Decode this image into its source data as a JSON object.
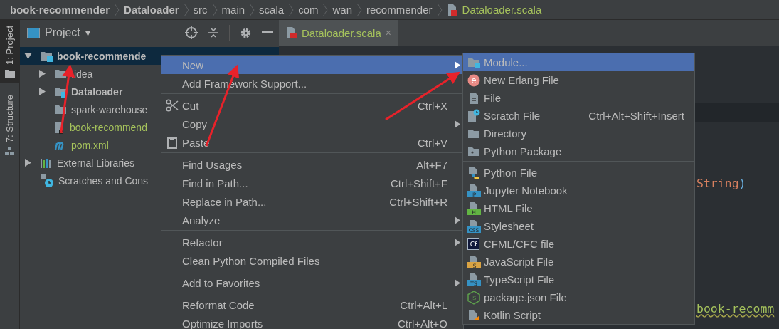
{
  "breadcrumbs": [
    {
      "label": "book-recommender",
      "kind": "module"
    },
    {
      "label": "Dataloader",
      "kind": "module"
    },
    {
      "label": "src",
      "kind": "folder"
    },
    {
      "label": "main",
      "kind": "folder"
    },
    {
      "label": "scala",
      "kind": "folder"
    },
    {
      "label": "com",
      "kind": "folder"
    },
    {
      "label": "wan",
      "kind": "folder"
    },
    {
      "label": "recommender",
      "kind": "folder"
    },
    {
      "label": "Dataloader.scala",
      "kind": "scala"
    }
  ],
  "tool_stripe": [
    {
      "label": "1: Project",
      "kind": "folder",
      "selected": true
    },
    {
      "label": "7: Structure",
      "kind": "structure",
      "selected": false
    }
  ],
  "project_panel": {
    "title": "Project",
    "dropdown": "▾",
    "tree": [
      {
        "label": "book-recommende",
        "kind": "module",
        "bold": true,
        "color": "#bbbbbb",
        "expanded": true,
        "selected": true,
        "children": [
          {
            "label": ".idea",
            "kind": "folder",
            "bold": false,
            "color": "#bbbbbb",
            "expanded": false,
            "selected": false
          },
          {
            "label": "Dataloader",
            "kind": "module",
            "bold": true,
            "color": "#bbbbbb",
            "expanded": false,
            "selected": false
          },
          {
            "label": "spark-warehouse",
            "kind": "folder",
            "bold": false,
            "color": "#bbbbbb",
            "selected": false
          },
          {
            "label": "book-recommend",
            "kind": "iml",
            "bold": false,
            "color": "#a5c25c",
            "selected": false
          },
          {
            "label": "pom.xml",
            "kind": "maven",
            "bold": false,
            "color": "#a5c25c",
            "selected": false
          }
        ]
      },
      {
        "label": "External Libraries",
        "kind": "libraries",
        "bold": false,
        "color": "#bbbbbb",
        "expanded": false,
        "selected": false
      },
      {
        "label": "Scratches and Cons",
        "kind": "scratches",
        "bold": false,
        "color": "#bbbbbb",
        "selected": false
      }
    ]
  },
  "editor_tabs": [
    {
      "label": "Dataloader.scala",
      "close": "×",
      "selected": true
    }
  ],
  "editor_code": [
    {
      "tokens": [
        {
          "text": "String",
          "kind": "type"
        },
        {
          "text": ")",
          "kind": "paren"
        }
      ]
    },
    {
      "tokens": [
        {
          "text": "book-recomm",
          "kind": "string"
        }
      ]
    }
  ],
  "context_menu": {
    "groups": [
      [
        {
          "label": "New",
          "submenu": true,
          "selected": true
        },
        {
          "label": "Add Framework Support...",
          "submenu": false,
          "selected": false
        }
      ],
      [
        {
          "label": "Cut",
          "kind": "cut",
          "shortcut": "Ctrl+X",
          "submenu": false,
          "selected": false
        },
        {
          "label": "Copy",
          "submenu": true,
          "selected": false
        },
        {
          "label": "Paste",
          "kind": "paste",
          "shortcut": "Ctrl+V",
          "submenu": false,
          "selected": false
        }
      ],
      [
        {
          "label": "Find Usages",
          "shortcut": "Alt+F7",
          "submenu": false,
          "selected": false
        },
        {
          "label": "Find in Path...",
          "shortcut": "Ctrl+Shift+F",
          "submenu": false,
          "selected": false
        },
        {
          "label": "Replace in Path...",
          "shortcut": "Ctrl+Shift+R",
          "submenu": false,
          "selected": false
        },
        {
          "label": "Analyze",
          "submenu": true,
          "selected": false
        }
      ],
      [
        {
          "label": "Refactor",
          "submenu": true,
          "selected": false
        },
        {
          "label": "Clean Python Compiled Files",
          "submenu": false,
          "selected": false
        }
      ],
      [
        {
          "label": "Add to Favorites",
          "submenu": true,
          "selected": false
        }
      ],
      [
        {
          "label": "Reformat Code",
          "shortcut": "Ctrl+Alt+L",
          "submenu": false,
          "selected": false
        },
        {
          "label": "Optimize Imports",
          "shortcut": "Ctrl+Alt+O",
          "submenu": false,
          "selected": false
        }
      ]
    ]
  },
  "submenu": {
    "groups": [
      [
        {
          "label": "Module...",
          "kind": "module",
          "selected": true
        },
        {
          "label": "New Erlang File",
          "kind": "erlang",
          "badge": "e",
          "selected": false
        },
        {
          "label": "File",
          "kind": "file",
          "selected": false
        },
        {
          "label": "Scratch File",
          "kind": "scratch-file",
          "shortcut": "Ctrl+Alt+Shift+Insert",
          "selected": false
        },
        {
          "label": "Directory",
          "kind": "folder",
          "selected": false
        },
        {
          "label": "Python Package",
          "kind": "package",
          "selected": false
        }
      ],
      [
        {
          "label": "Python File",
          "kind": "python",
          "selected": false
        },
        {
          "label": "Jupyter Notebook",
          "kind": "badge-file",
          "badge": "IP",
          "color": "#3592c4",
          "selected": false
        },
        {
          "label": "HTML File",
          "kind": "badge-file",
          "badge": "H",
          "color": "#62b543",
          "selected": false
        },
        {
          "label": "Stylesheet",
          "kind": "badge-file",
          "badge": "CSS",
          "color": "#3592c4",
          "selected": false
        },
        {
          "label": "CFML/CFC file",
          "kind": "cfml",
          "badge": "Cf",
          "selected": false
        },
        {
          "label": "JavaScript File",
          "kind": "badge-file",
          "badge": "JS",
          "color": "#d9a343",
          "selected": false
        },
        {
          "label": "TypeScript File",
          "kind": "badge-file",
          "badge": "TS",
          "color": "#3592c4",
          "selected": false
        },
        {
          "label": "package.json File",
          "kind": "nodejs",
          "badge": "JS",
          "selected": false
        },
        {
          "label": "Kotlin Script",
          "kind": "kotlin",
          "selected": false
        }
      ]
    ]
  }
}
